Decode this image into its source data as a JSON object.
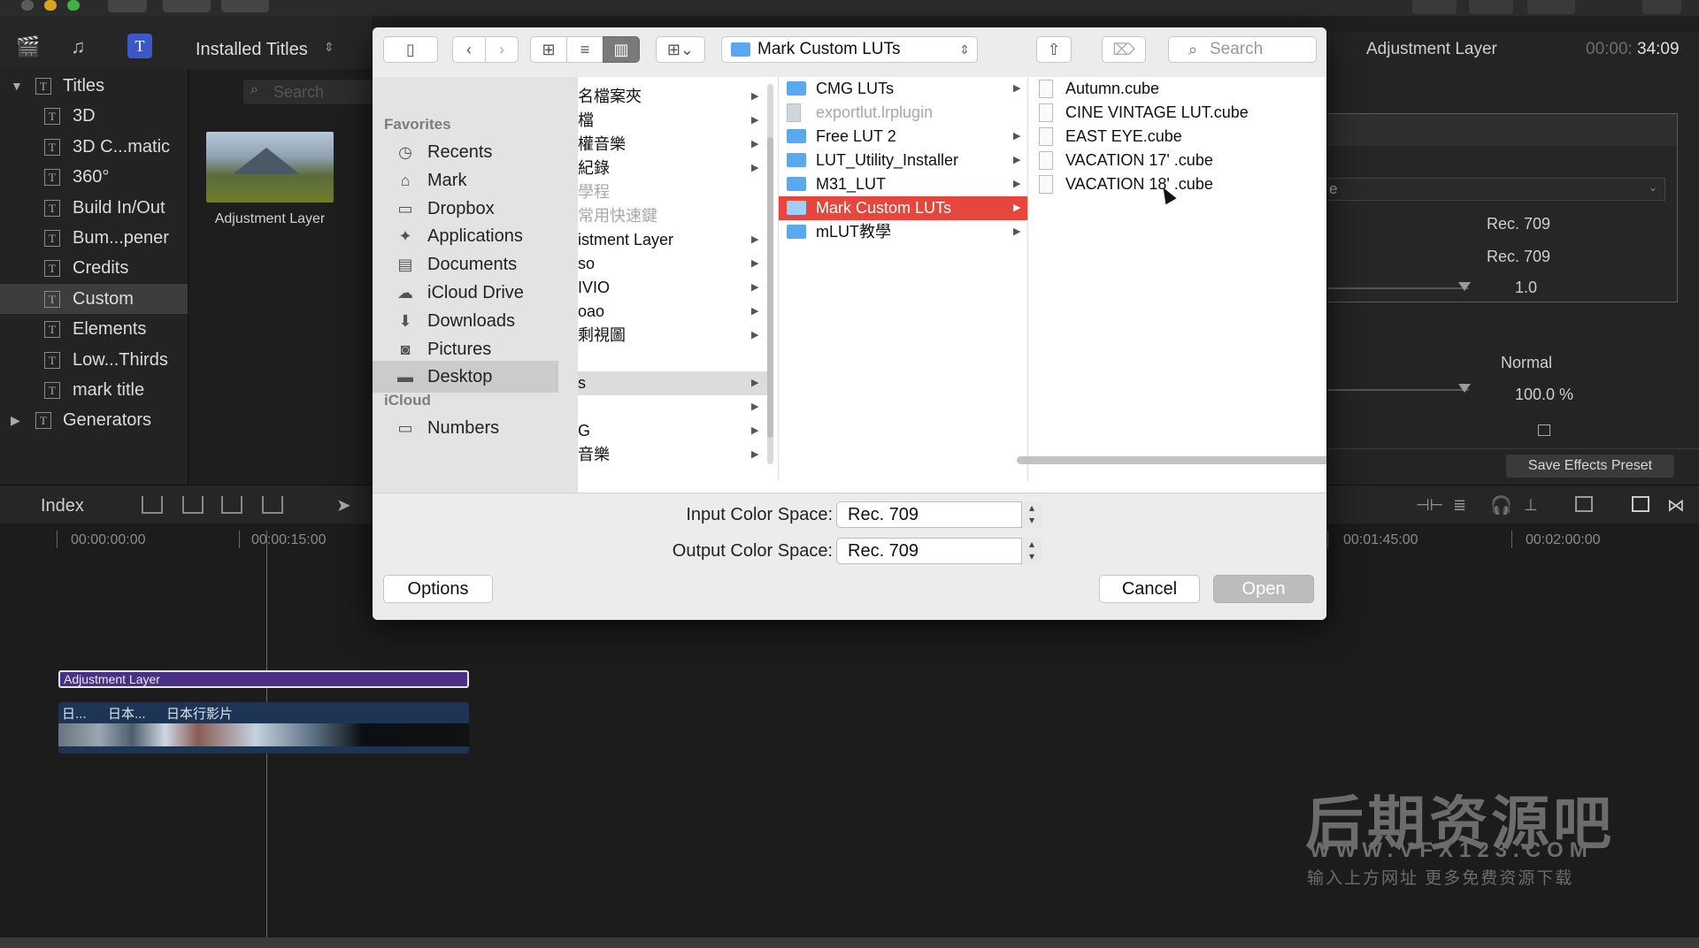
{
  "app": {
    "browser_title": "Installed Titles",
    "search_placeholder": "Search",
    "thumbnail_label": "Adjustment Layer",
    "index_label": "Index"
  },
  "sidebar": {
    "items": [
      {
        "label": "Titles",
        "level": 0,
        "expanded": true
      },
      {
        "label": "3D",
        "level": 1
      },
      {
        "label": "3D C...matic",
        "level": 1
      },
      {
        "label": "360°",
        "level": 1
      },
      {
        "label": "Build In/Out",
        "level": 1
      },
      {
        "label": "Bum...pener",
        "level": 1
      },
      {
        "label": "Credits",
        "level": 1
      },
      {
        "label": "Custom",
        "level": 1,
        "selected": true
      },
      {
        "label": "Elements",
        "level": 1
      },
      {
        "label": "Low...Thirds",
        "level": 1
      },
      {
        "label": "mark title",
        "level": 1
      },
      {
        "label": "Generators",
        "level": 0,
        "expanded": false
      }
    ]
  },
  "inspector": {
    "title": "Adjustment Layer",
    "timecode_dim": "00:00:",
    "timecode": "34:09",
    "field_partial": "e",
    "rec_a": "Rec. 709",
    "rec_b": "Rec. 709",
    "value_a": "1.0",
    "blend": "Normal",
    "opacity": "100.0 %",
    "save_preset": "Save Effects Preset"
  },
  "timeline": {
    "ruler": [
      "00:00:00:00",
      "00:00:15:00",
      "00:01:45:00",
      "00:02:00:00"
    ],
    "adjustment_clip": "Adjustment Layer",
    "clips": [
      "日...",
      "日本...",
      "日本行影片"
    ]
  },
  "watermark": {
    "title": "后期资源吧",
    "url": "WWW.VFX123.COM",
    "tagline": "输入上方网址 更多免费资源下载"
  },
  "dialog": {
    "location": "Mark Custom LUTs",
    "search_placeholder": "Search",
    "sidebar": {
      "favorites_header": "Favorites",
      "favorites": [
        {
          "label": "Recents",
          "icon": "clock-icon"
        },
        {
          "label": "Mark",
          "icon": "home-icon"
        },
        {
          "label": "Dropbox",
          "icon": "folder-icon"
        },
        {
          "label": "Applications",
          "icon": "applications-icon"
        },
        {
          "label": "Documents",
          "icon": "document-icon"
        },
        {
          "label": "iCloud Drive",
          "icon": "cloud-icon"
        },
        {
          "label": "Downloads",
          "icon": "download-icon"
        },
        {
          "label": "Pictures",
          "icon": "camera-icon"
        },
        {
          "label": "Desktop",
          "icon": "desktop-icon",
          "selected": true
        }
      ],
      "icloud_header": "iCloud",
      "icloud": [
        {
          "label": "Numbers",
          "icon": "folder-icon"
        }
      ]
    },
    "column1": [
      {
        "label": "名檔案夾",
        "arrow": true
      },
      {
        "label": "檔",
        "arrow": true
      },
      {
        "label": "權音樂",
        "arrow": true
      },
      {
        "label": "紀錄",
        "arrow": true
      },
      {
        "label": "學程",
        "arrow": false,
        "dim": true
      },
      {
        "label": "常用快速鍵",
        "arrow": false,
        "dim": true
      },
      {
        "label": "istment Layer",
        "arrow": true
      },
      {
        "label": "so",
        "arrow": true
      },
      {
        "label": "IVIO",
        "arrow": true
      },
      {
        "label": "oao",
        "arrow": true
      },
      {
        "label": "剩視圖",
        "arrow": true
      },
      {
        "label": "",
        "arrow": false
      },
      {
        "label": "s",
        "arrow": true,
        "highlight": true
      },
      {
        "label": "",
        "arrow": true
      },
      {
        "label": "G",
        "arrow": true
      },
      {
        "label": "音樂",
        "arrow": true
      }
    ],
    "column2": [
      {
        "label": "CMG LUTs",
        "type": "folder"
      },
      {
        "label": "exportlut.lrplugin",
        "type": "plugin",
        "dim": true
      },
      {
        "label": "Free LUT 2",
        "type": "folder"
      },
      {
        "label": "LUT_Utility_Installer",
        "type": "folder"
      },
      {
        "label": "M31_LUT",
        "type": "folder"
      },
      {
        "label": "Mark Custom LUTs",
        "type": "folder",
        "selected": true
      },
      {
        "label": "mLUT教學",
        "type": "folder"
      }
    ],
    "column3": [
      {
        "label": "Autumn.cube"
      },
      {
        "label": "CINE VINTAGE LUT.cube"
      },
      {
        "label": "EAST EYE.cube"
      },
      {
        "label": "VACATION 17' .cube"
      },
      {
        "label": "VACATION 18' .cube"
      }
    ],
    "input_label": "Input Color Space:",
    "input_value": "Rec. 709",
    "output_label": "Output Color Space:",
    "output_value": "Rec. 709",
    "options_button": "Options",
    "cancel_button": "Cancel",
    "open_button": "Open"
  }
}
